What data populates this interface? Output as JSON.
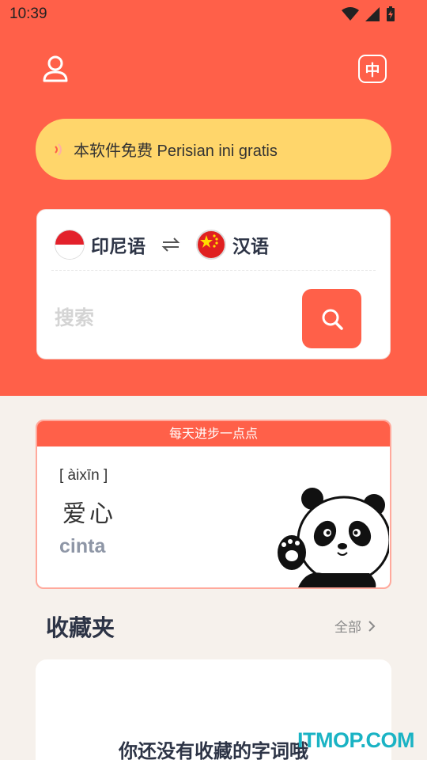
{
  "status_bar": {
    "time": "10:39"
  },
  "header": {
    "user_icon": "user-icon",
    "language_toggle_label": "中"
  },
  "notice": {
    "text": "本软件免费 Perisian ini gratis"
  },
  "translator": {
    "source_language": "印尼语",
    "target_language": "汉语",
    "search_placeholder": "搜索"
  },
  "daily": {
    "header": "每天进步一点点",
    "pinyin": "[ àixīn ]",
    "hanzi": "爱心",
    "word": "cinta"
  },
  "favorites": {
    "title": "收藏夹",
    "all_label": "全部",
    "empty_text": "你还没有收藏的字词哦"
  },
  "watermark": "ITMOP.COM",
  "colors": {
    "accent": "#ff6049",
    "notice": "#ffd66b",
    "card_border": "#ffa99c"
  }
}
